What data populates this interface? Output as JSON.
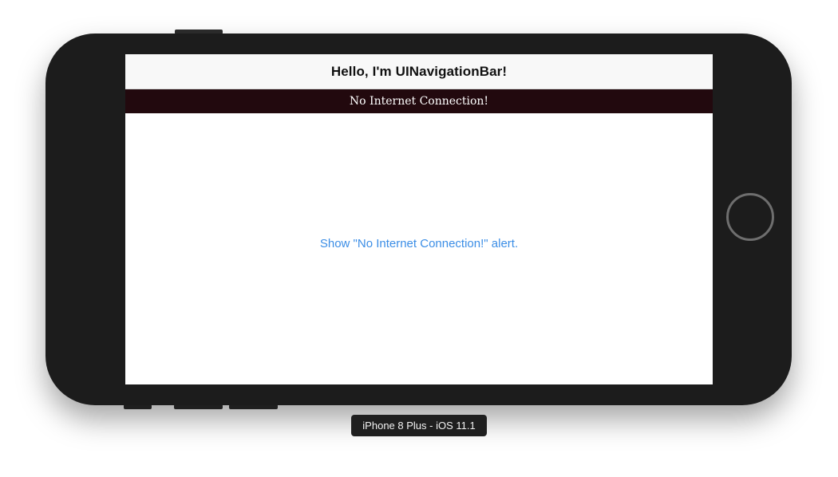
{
  "screen": {
    "nav_title": "Hello, I'm UINavigationBar!",
    "alert_banner_text": "No Internet Connection!",
    "show_alert_button": "Show \"No Internet Connection!\" alert."
  },
  "simulator": {
    "label": "iPhone 8 Plus - iOS 11.1"
  },
  "colors": {
    "banner_background": "#22090e",
    "link_tint": "#3c8ee6",
    "device_body": "#1c1c1c"
  }
}
